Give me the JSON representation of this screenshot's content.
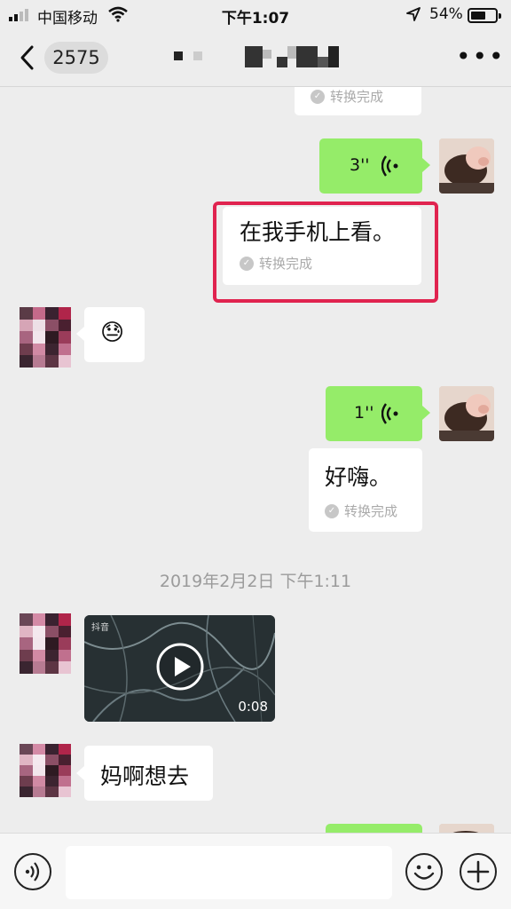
{
  "status_bar": {
    "carrier": "中国移动",
    "time": "下午1:07",
    "battery_percent": "54%"
  },
  "nav": {
    "unread_count": "2575",
    "more_label": "•••"
  },
  "messages": {
    "m1_convert": "转换完成",
    "m2_voice_length": "3''",
    "m3_text": "在我手机上看。",
    "m3_convert": "转换完成",
    "m4_emoji": "😓",
    "m5_voice_length": "1''",
    "m6_text": "好嗨。",
    "m6_convert": "转换完成",
    "timestamp": "2019年2月2日 下午1:11",
    "video_logo": "抖音",
    "video_duration": "0:08",
    "m8_text": "妈啊想去"
  },
  "input": {
    "placeholder": ""
  },
  "colors": {
    "background": "#ededed",
    "sent_bubble": "#95ec69",
    "received_bubble": "#ffffff",
    "highlight_box": "#e0234f"
  },
  "icons": {
    "voice_toggle": "voice-wave-icon",
    "emoji": "smiley-icon",
    "plus": "plus-icon",
    "back": "chevron-left-icon"
  }
}
